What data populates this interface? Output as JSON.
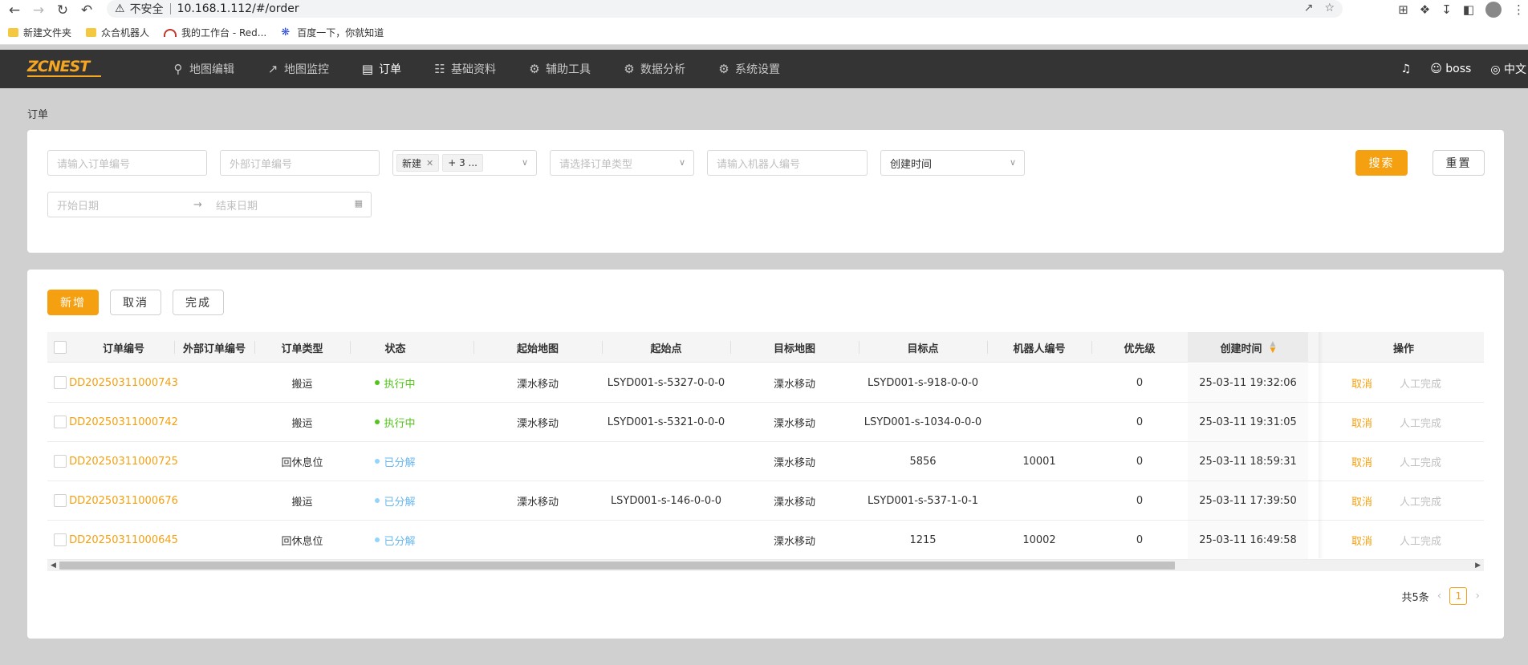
{
  "browser": {
    "insecure_label": "不安全",
    "url": "10.168.1.112/#/order",
    "bookmarks": [
      "新建文件夹",
      "众合机器人",
      "我的工作台 - Red...",
      "百度一下，你就知道"
    ]
  },
  "nav": {
    "logo": "ZCNEST",
    "items": [
      {
        "label": "地图编辑",
        "icon": "map-pin-icon"
      },
      {
        "label": "地图监控",
        "icon": "chart-line-icon"
      },
      {
        "label": "订单",
        "icon": "document-icon",
        "active": true
      },
      {
        "label": "基础资料",
        "icon": "sliders-icon"
      },
      {
        "label": "辅助工具",
        "icon": "gear-icon"
      },
      {
        "label": "数据分析",
        "icon": "gear-icon"
      },
      {
        "label": "系统设置",
        "icon": "gear-icon"
      }
    ],
    "user": "boss",
    "language": "中文"
  },
  "breadcrumb": "订单",
  "filters": {
    "order_no_placeholder": "请输入订单编号",
    "external_no_placeholder": "外部订单编号",
    "status_tag": "新建",
    "status_more": "+ 3 ...",
    "order_type_placeholder": "请选择订单类型",
    "robot_no_placeholder": "请输入机器人编号",
    "time_type": "创建时间",
    "start_date_placeholder": "开始日期",
    "end_date_placeholder": "结束日期",
    "search_label": "搜索",
    "reset_label": "重置"
  },
  "actions": {
    "add_label": "新增",
    "cancel_label": "取消",
    "complete_label": "完成"
  },
  "table": {
    "headers": [
      "订单编号",
      "外部订单编号",
      "订单类型",
      "状态",
      "起始地图",
      "起始点",
      "目标地图",
      "目标点",
      "机器人编号",
      "优先级",
      "创建时间",
      "操作"
    ],
    "rows": [
      {
        "order_no": "DD20250311000743",
        "external_no": "",
        "type": "搬运",
        "status": "执行中",
        "status_color": "#52c41a",
        "start_map": "溧水移动",
        "start_point": "LSYD001-s-5327-0-0-0",
        "target_map": "溧水移动",
        "target_point": "LSYD001-s-918-0-0-0",
        "robot_no": "",
        "priority": "0",
        "created": "25-03-11 19:32:06",
        "op_cancel": "取消",
        "op_manual": "人工完成"
      },
      {
        "order_no": "DD20250311000742",
        "external_no": "",
        "type": "搬运",
        "status": "执行中",
        "status_color": "#52c41a",
        "start_map": "溧水移动",
        "start_point": "LSYD001-s-5321-0-0-0",
        "target_map": "溧水移动",
        "target_point": "LSYD001-s-1034-0-0-0",
        "robot_no": "",
        "priority": "0",
        "created": "25-03-11 19:31:05",
        "op_cancel": "取消",
        "op_manual": "人工完成"
      },
      {
        "order_no": "DD20250311000725",
        "external_no": "",
        "type": "回休息位",
        "status": "已分解",
        "status_color": "#91d5ff",
        "start_map": "",
        "start_point": "",
        "target_map": "溧水移动",
        "target_point": "5856",
        "robot_no": "10001",
        "priority": "0",
        "created": "25-03-11 18:59:31",
        "op_cancel": "取消",
        "op_manual": "人工完成"
      },
      {
        "order_no": "DD20250311000676",
        "external_no": "",
        "type": "搬运",
        "status": "已分解",
        "status_color": "#91d5ff",
        "start_map": "溧水移动",
        "start_point": "LSYD001-s-146-0-0-0",
        "target_map": "溧水移动",
        "target_point": "LSYD001-s-537-1-0-1",
        "robot_no": "",
        "priority": "0",
        "created": "25-03-11 17:39:50",
        "op_cancel": "取消",
        "op_manual": "人工完成"
      },
      {
        "order_no": "DD20250311000645",
        "external_no": "",
        "type": "回休息位",
        "status": "已分解",
        "status_color": "#91d5ff",
        "start_map": "",
        "start_point": "",
        "target_map": "溧水移动",
        "target_point": "1215",
        "robot_no": "10002",
        "priority": "0",
        "created": "25-03-11 16:49:58",
        "op_cancel": "取消",
        "op_manual": "人工完成"
      }
    ]
  },
  "pagination": {
    "total_label": "共5条",
    "current_page": "1"
  },
  "colors": {
    "accent": "#f5a010",
    "nav_bg": "#343434",
    "running": "#52c41a",
    "decomposed": "#91d5ff"
  }
}
